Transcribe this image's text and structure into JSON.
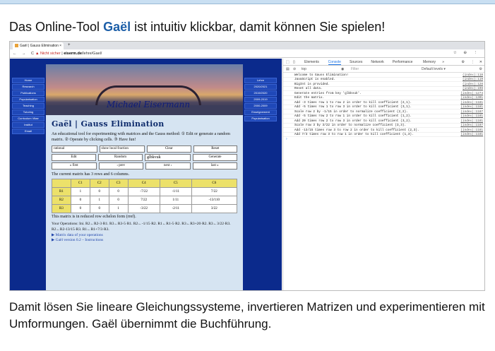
{
  "heading": {
    "pre": "Das Online-Tool ",
    "brand": "Gaël",
    "post": " ist intuitiv klickbar, damit können Sie spielen!"
  },
  "caption": "Damit lösen Sie lineare Gleichungssysteme, invertieren Matrizen und experimentieren mit Umformungen. Gaël übernimmt die Buchführung.",
  "browser": {
    "tab_title": "Gaël | Gauss Elimination",
    "tab_close": "×",
    "new_tab": "+",
    "nav": "← → C",
    "url_warning": "▲ Nicht sicher",
    "url_domain": "eiserm.de",
    "url_path": "/lehre/Gael/",
    "right_icons": "☆ ⊖ ⋮"
  },
  "site": {
    "left_nav": [
      "Home",
      "Research",
      "Publications",
      "Popularisation",
      "Teaching",
      "Tutoring",
      "Curriculum Vitae",
      "Institut",
      "Email"
    ],
    "right_nav": [
      "Lehre",
      "2020/2021",
      "2019/2020",
      "2009-2019",
      "2000-2009",
      "Enseignement",
      "Popularisation"
    ],
    "signature": "Michael Eisermann",
    "title": "Gaël | Gauss Elimination",
    "description": "An educational tool for experimenting with matrices and the Gauss method: ① Edit or generate a random matrix. ② Operate by clicking cells. ③ Have fun!",
    "controls": {
      "row1": [
        "rational",
        "show local fraction",
        "Clear",
        "Reset"
      ],
      "row2": [
        "Edit",
        "Random",
        "glbkvuk",
        "Generate"
      ],
      "row3": [
        "« first",
        "‹ prev",
        "next ›",
        "last »"
      ]
    },
    "matrix_info": "The current matrix has 3 rows and 6 columns.",
    "matrix": {
      "headers": [
        "",
        "C1",
        "C2",
        "C3",
        "C4",
        "C5",
        "C6"
      ],
      "rows": [
        [
          "R1",
          "1",
          "0",
          "0",
          "-7/22",
          "-1/11",
          "7/22"
        ],
        [
          "R2",
          "0",
          "1",
          "0",
          "7/22",
          "1/11",
          "-13/110"
        ],
        [
          "R3",
          "0",
          "0",
          "1",
          "-3/22",
          "-2/11",
          "3/22"
        ]
      ]
    },
    "ref_text": "This matrix is in reduced row echelon form (rref).",
    "operations": "Your Operations: Ini. R2←R2-3·R1. R3←R3-5·R1. R2←-1/15·R2. R1←R1-5·R2. R3←R3+20·R2. R3←3/22·R3. R2←R2-13/15·R3. R1←R1+7/3·R3.",
    "links": [
      "▶ Matrix data of your operations",
      "▶ Gaël version 0.2 – Instructions"
    ]
  },
  "devtools": {
    "tabs": [
      "Elements",
      "Console",
      "Sources",
      "Network",
      "Performance",
      "Memory",
      "»"
    ],
    "active_tab": "Console",
    "context": "top",
    "filter_placeholder": "Filter",
    "levels": "Default levels ▾",
    "log": [
      {
        "msg": "Welcome to Gauss Elimination!",
        "src": "(index):118"
      },
      {
        "msg": "JavaScript is enabled.",
        "src": "(index):119"
      },
      {
        "msg": "BigInt is provided.",
        "src": "(index):128"
      },
      {
        "msg": "Reset all data.",
        "src": "(index):198"
      },
      {
        "msg": "Generate entries from key 'glbkvuk'.",
        "src": "(index):1274"
      },
      {
        "msg": "Edit the matrix.",
        "src": "(index):1301"
      },
      {
        "msg": "Add -3 times row 1 to row 2 in order to kill coefficient (2,1).",
        "src": "(index):1181"
      },
      {
        "msg": "Add -5 times row 1 to row 3 in order to kill coefficient (3,1).",
        "src": "(index):1181"
      },
      {
        "msg": "Scale row 2 by -1/15 in order to normalize coefficient (2,2).",
        "src": "(index):1187"
      },
      {
        "msg": "Add -5 times row 2 to row 1 in order to kill coefficient (1,2).",
        "src": "(index):1181"
      },
      {
        "msg": "Add 20 times row 2 to row 3 in order to kill coefficient (3,2).",
        "src": "(index):1181"
      },
      {
        "msg": "Scale row 3 by 3/22 in order to normalize coefficient (3,3).",
        "src": "(index):1187"
      },
      {
        "msg": "Add -13/15 times row 3 to row 2 in order to kill coefficient (2,3).",
        "src": "(index):1181"
      },
      {
        "msg": "Add 7/3 times row 3 to row 1 in order to kill coefficient (1,3).",
        "src": "(index):1181"
      }
    ],
    "prompt": "›"
  }
}
